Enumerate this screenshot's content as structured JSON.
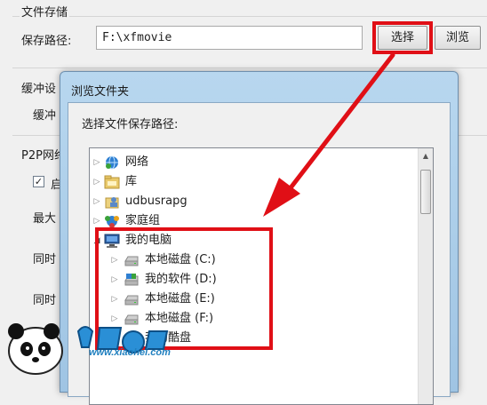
{
  "settings": {
    "file_storage_title": "文件存储",
    "save_path_label": "保存路径:",
    "save_path_value": "F:\\xfmovie",
    "select_button": "选择",
    "browse_button": "浏览",
    "buffer_title": "缓冲设",
    "buffer_label": "缓冲",
    "p2p_title": "P2P网络",
    "p2p_check_label": "启",
    "max_label": "最大",
    "same_label_1": "同时",
    "same_label_2": "同时"
  },
  "dialog": {
    "title": "浏览文件夹",
    "prompt": "选择文件保存路径:",
    "tree": [
      {
        "label": "网络",
        "icon": "network-icon",
        "expanded": false
      },
      {
        "label": "库",
        "icon": "library-icon",
        "expanded": false
      },
      {
        "label": "udbusrapg",
        "icon": "user-folder-icon",
        "expanded": false
      },
      {
        "label": "家庭组",
        "icon": "homegroup-icon",
        "expanded": false
      },
      {
        "label": "我的电脑",
        "icon": "computer-icon",
        "expanded": true
      },
      {
        "label": "本地磁盘 (C:)",
        "icon": "drive-icon",
        "expanded": false
      },
      {
        "label": "我的软件 (D:)",
        "icon": "drive-icon",
        "expanded": false
      },
      {
        "label": "本地磁盘 (E:)",
        "icon": "drive-icon",
        "expanded": false
      },
      {
        "label": "本地磁盘 (F:)",
        "icon": "drive-icon",
        "expanded": false
      },
      {
        "label": "我的酷盘",
        "icon": "cloud-drive-icon",
        "expanded": false
      }
    ]
  },
  "watermark": {
    "url": "www.xiaohei.com"
  },
  "colors": {
    "highlight": "#e00f16",
    "arrow": "#e00f16"
  }
}
